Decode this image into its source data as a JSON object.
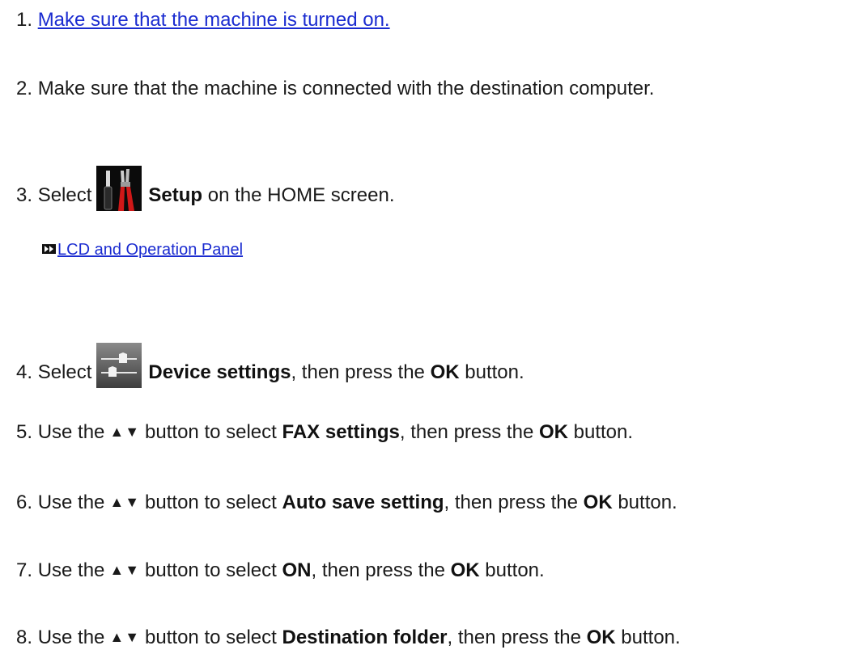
{
  "steps": [
    {
      "num": "1.",
      "link": "Make sure that the machine is turned on."
    },
    {
      "num": "2.",
      "text": "Make sure that the machine is connected with the destination computer."
    },
    {
      "num": "3.",
      "pre": "Select",
      "bold": "Setup",
      "post": "on the HOME screen.",
      "icon": "setup-tools-icon",
      "sublink": "LCD and Operation Panel"
    },
    {
      "num": "4.",
      "pre": "Select",
      "bold": "Device settings",
      "mid": ", then press the",
      "bold2": "OK",
      "post": "button.",
      "icon": "device-settings-icon"
    },
    {
      "num": "5.",
      "pre": "Use the",
      "arrows": "▲▼",
      "mid": "button to select",
      "bold": "FAX settings",
      "mid2": ", then press the",
      "bold2": "OK",
      "post": "button."
    },
    {
      "num": "6.",
      "pre": "Use the",
      "arrows": "▲▼",
      "mid": "button to select",
      "bold": "Auto save setting",
      "mid2": ", then press the",
      "bold2": "OK",
      "post": "button."
    },
    {
      "num": "7.",
      "pre": "Use the",
      "arrows": "▲▼",
      "mid": "button to select",
      "bold": "ON",
      "mid2": ", then press the",
      "bold2": "OK",
      "post": "button."
    },
    {
      "num": "8.",
      "pre": "Use the",
      "arrows": "▲▼",
      "mid": "button to select",
      "bold": "Destination folder",
      "mid2": ", then press the",
      "bold2": "OK",
      "post": "button."
    }
  ],
  "colors": {
    "link": "#1a2bd0",
    "text": "#1a1a1a"
  }
}
